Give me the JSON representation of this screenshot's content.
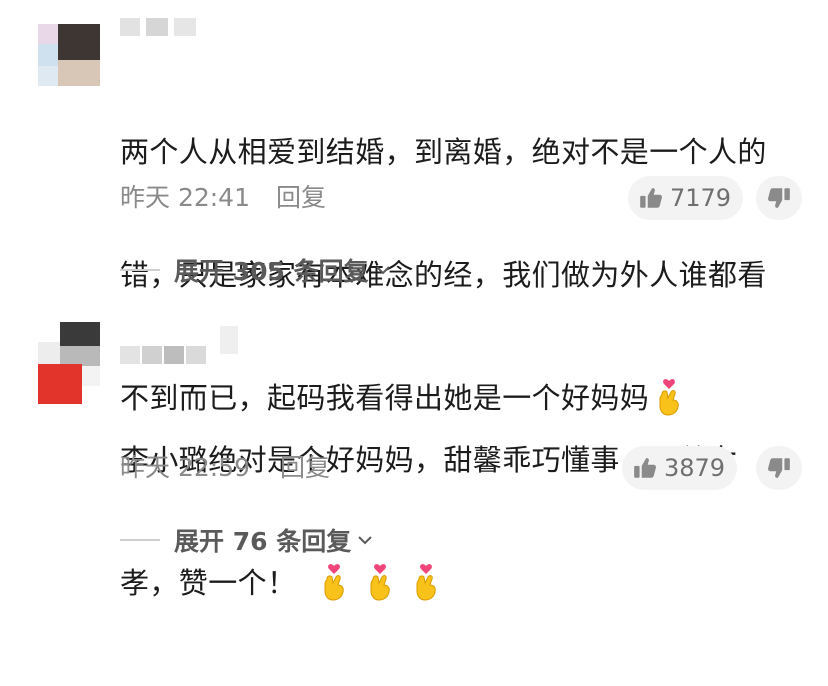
{
  "comments": [
    {
      "text_lines": [
        "两个人从相爱到结婚，到离婚，绝对不是一个人的",
        "错，只是家家有本难念的经，我们做为外人谁都看",
        "不到而已，起码我看得出她是一个好妈妈"
      ],
      "emoji": "finger-heart-emoji",
      "time": "昨天 22:41",
      "reply_label": "回复",
      "likes": "7179",
      "expand_label": "展开 305 条回复"
    },
    {
      "text_lines": [
        "李小璐绝对是个好妈妈，甜馨乖巧懂事，母慈女",
        "孝，赞一个！"
      ],
      "emoji": "finger-heart-emoji",
      "time": "昨天 22:59",
      "reply_label": "回复",
      "likes": "3879",
      "expand_label": "展开 76 条回复"
    }
  ],
  "colors": {
    "text": "#1c1c1c",
    "meta": "#8a8a8a",
    "pill_bg": "#f3f3f3",
    "expand_text": "#5a5a5a"
  },
  "icons": {
    "like": "thumbs-up-icon",
    "dislike": "thumbs-down-icon",
    "expand": "chevron-down-icon"
  }
}
